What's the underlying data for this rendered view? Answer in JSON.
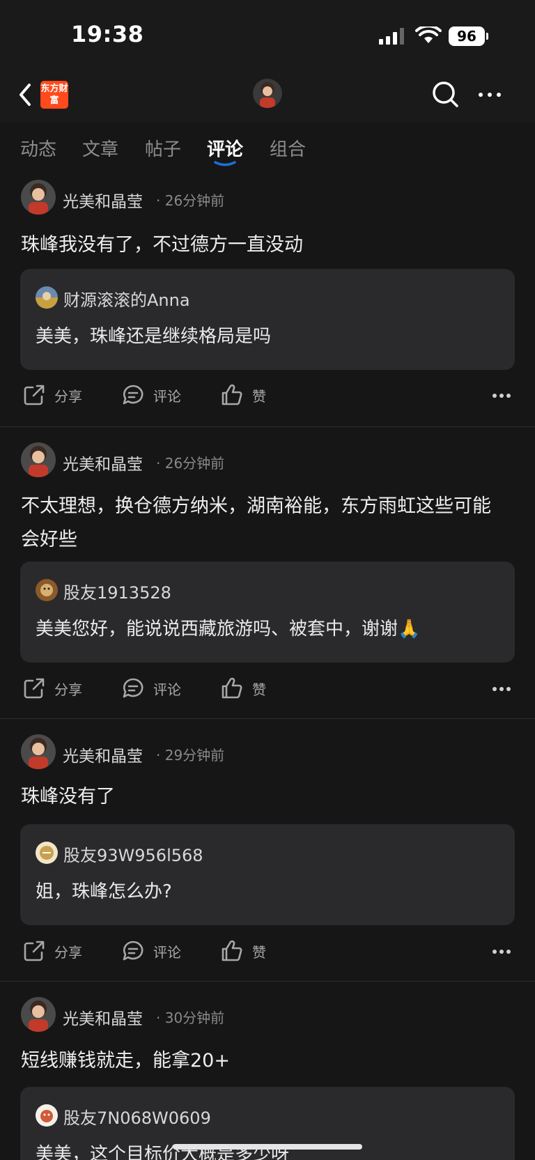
{
  "status": {
    "time": "19:38",
    "battery": "96"
  },
  "header": {
    "logo_text": "东方财富"
  },
  "tabs": [
    {
      "label": "动态"
    },
    {
      "label": "文章"
    },
    {
      "label": "帖子"
    },
    {
      "label": "评论",
      "active": true
    },
    {
      "label": "组合"
    }
  ],
  "posts": [
    {
      "author": "光美和晶莹",
      "time": "· 26分钟前",
      "text": "珠峰我没有了，不过德方一直没动",
      "quote_author": "财源滚滚的Anna",
      "quote_text": "美美，珠峰还是继续格局是吗"
    },
    {
      "author": "光美和晶莹",
      "time": "· 26分钟前",
      "text": "不太理想，换仓德方纳米，湖南裕能，东方雨虹这些可能会好些",
      "quote_author": "股友1913528",
      "quote_text": "美美您好，能说说西藏旅游吗、被套中，谢谢🙏"
    },
    {
      "author": "光美和晶莹",
      "time": "· 29分钟前",
      "text": "珠峰没有了",
      "quote_author": "股友93W956l568",
      "quote_text": "姐，珠峰怎么办?"
    },
    {
      "author": "光美和晶莹",
      "time": "· 30分钟前",
      "text": "短线赚钱就走，能拿20+",
      "quote_author": "股友7N068W0609",
      "quote_text": "美美，这个目标价大概是多少呀"
    }
  ],
  "actions": {
    "share": "分享",
    "comment": "评论",
    "like": "赞"
  },
  "colors": {
    "background": "#161616",
    "card": "#2a2a2c",
    "accent": "#1e6fd9",
    "logo": "#ff4a1c"
  }
}
